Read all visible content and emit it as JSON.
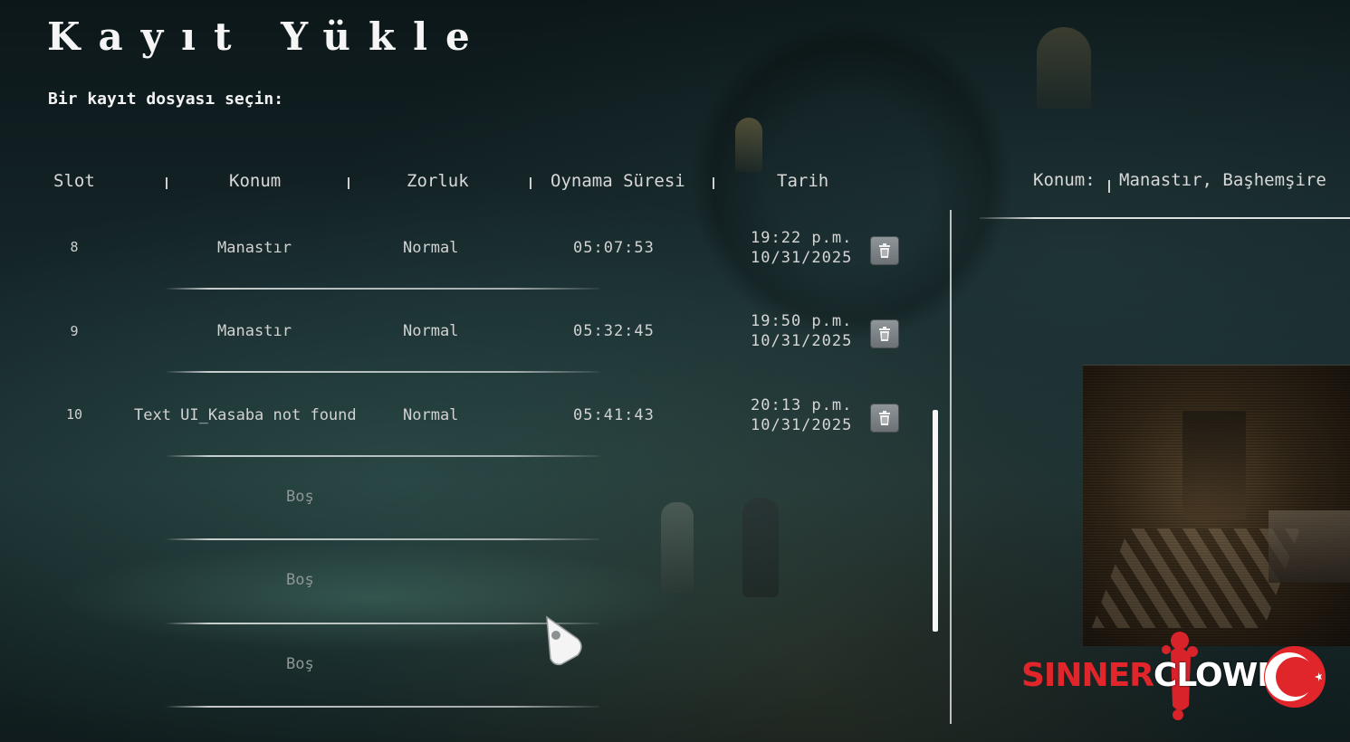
{
  "title": "Kayıt Yükle",
  "subtitle": "Bir kayıt dosyası seçin:",
  "columns": [
    "Slot",
    "Konum",
    "Zorluk",
    "Oynama Süresi",
    "Tarih"
  ],
  "saves": [
    {
      "slot": "8",
      "location": "Manastır",
      "difficulty": "Normal",
      "playtime": "05:07:53",
      "time": "19:22 p.m.",
      "date": "10/31/2025"
    },
    {
      "slot": "9",
      "location": "Manastır",
      "difficulty": "Normal",
      "playtime": "05:32:45",
      "time": "19:50 p.m.",
      "date": "10/31/2025"
    },
    {
      "slot": "10",
      "location": "Text UI_Kasaba not found",
      "difficulty": "Normal",
      "playtime": "05:41:43",
      "time": "20:13 p.m.",
      "date": "10/31/2025"
    }
  ],
  "empty_slots": [
    "Boş",
    "Boş",
    "Boş"
  ],
  "details": {
    "location_label": "Konum:",
    "location_value": "Manastır, Başhemşire"
  },
  "logo": {
    "part1": "SINNER",
    "part2": "CLOWN",
    "part1_color": "#e0262a",
    "part2_color": "#ffffff"
  },
  "icons": {
    "delete": "trash-icon",
    "cursor": "hand-cursor-icon"
  }
}
